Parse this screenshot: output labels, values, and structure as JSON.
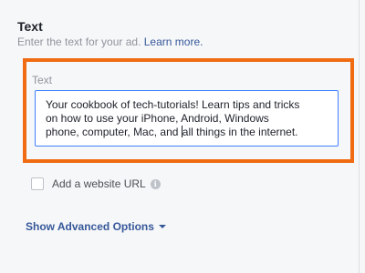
{
  "section": {
    "title": "Text",
    "description": "Enter the text for your ad.",
    "learn_more": "Learn more."
  },
  "text_field": {
    "label": "Text",
    "lines": [
      "Your cookbook of tech-tutorials! Learn tips and tricks",
      "on how to use your iPhone, Android, Windows",
      "phone, computer, Mac, and ",
      "all things in the internet."
    ]
  },
  "website_url": {
    "label": "Add a website URL",
    "checked": false,
    "info_icon": "info-icon"
  },
  "advanced_options": {
    "label": "Show Advanced Options",
    "icon": "caret-down-icon"
  },
  "colors": {
    "highlight": "#f06b12",
    "link": "#365899",
    "focus_border": "#4080ff"
  }
}
